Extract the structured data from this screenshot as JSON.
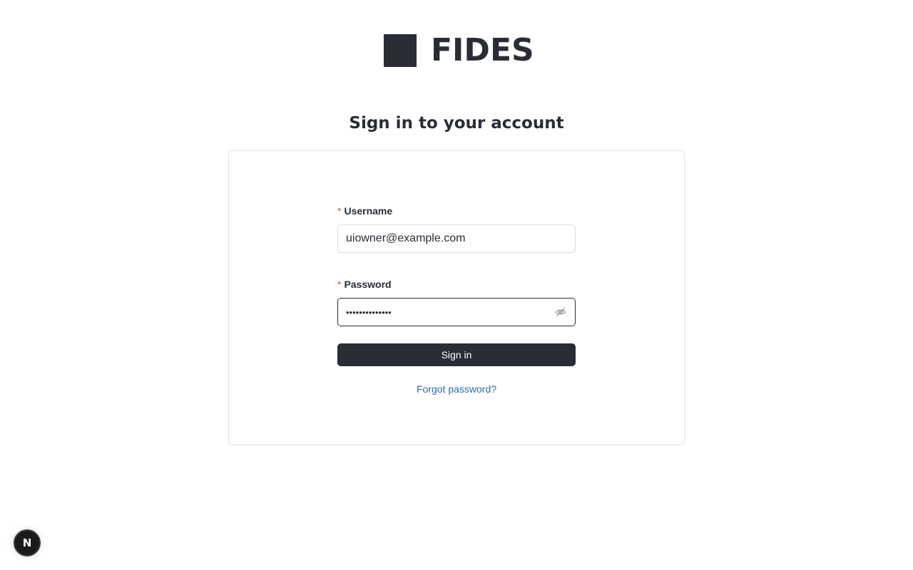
{
  "brand": {
    "name": "FIDES",
    "color": "#2a2d35"
  },
  "heading": "Sign in to your account",
  "form": {
    "username": {
      "label": "Username",
      "required_marker": "*",
      "value": "uiowner@example.com"
    },
    "password": {
      "label": "Password",
      "required_marker": "*",
      "masked_value": "••••••••••••••",
      "toggle_icon": "eye-off-icon"
    },
    "submit_label": "Sign in",
    "forgot_label": "Forgot password?"
  },
  "dev_badge": {
    "icon": "nextjs-logo-icon",
    "letter": "N"
  },
  "colors": {
    "primary": "#2a2d35",
    "required": "#e5484d",
    "link": "#2b6cb0",
    "border": "#d9dbe1"
  }
}
